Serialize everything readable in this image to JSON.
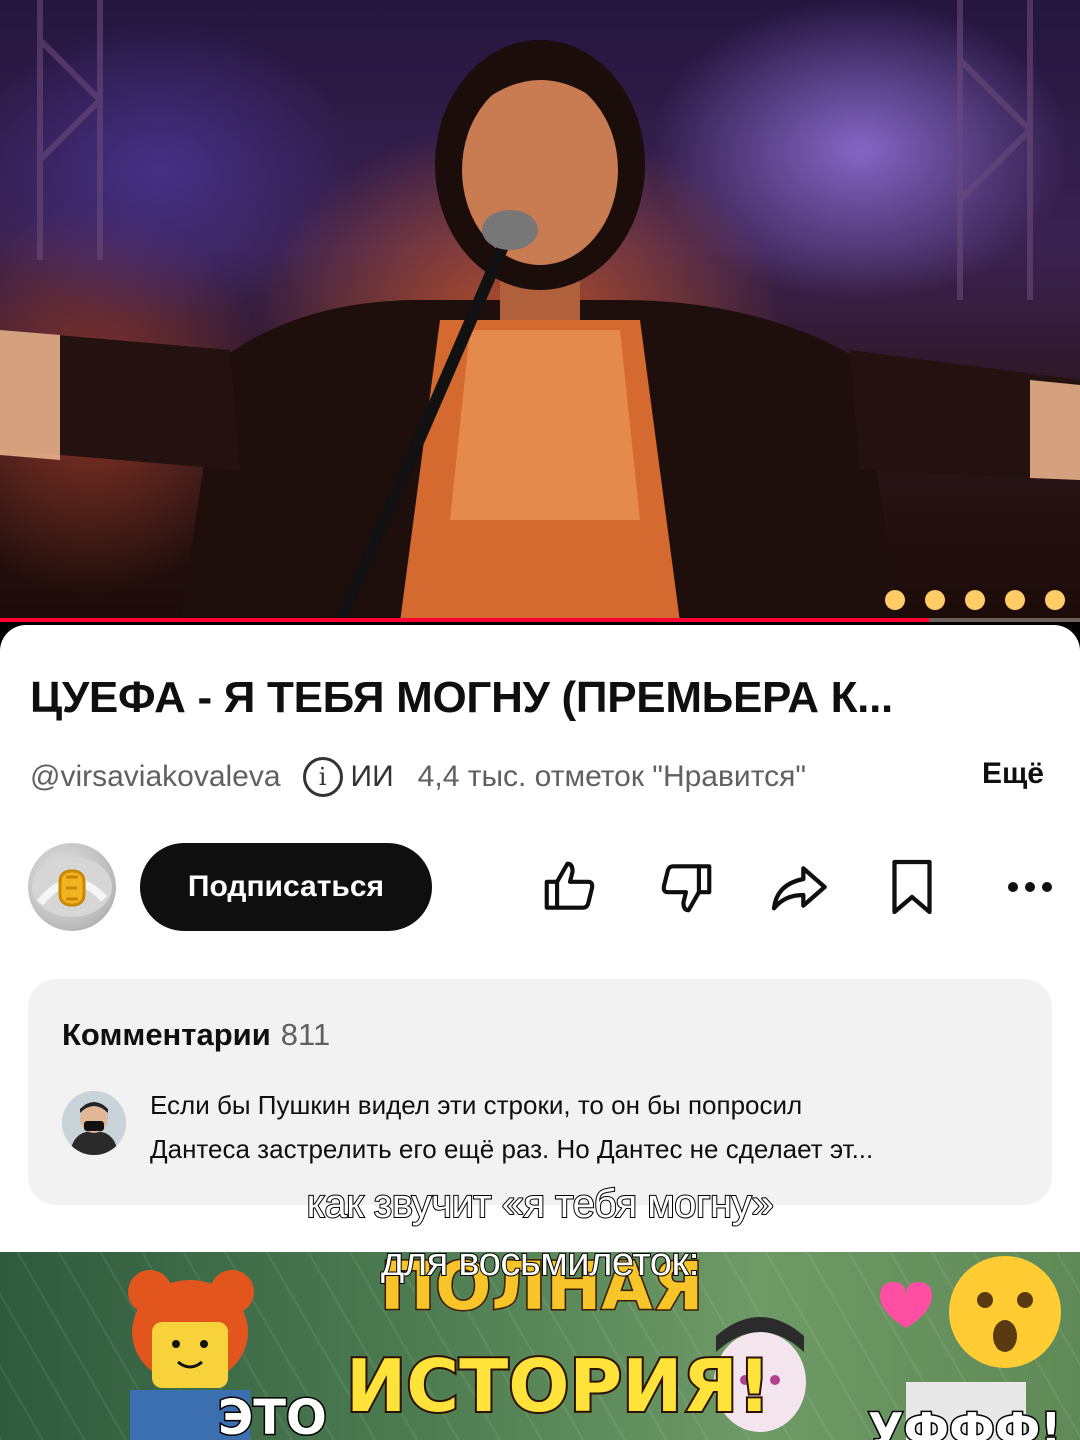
{
  "video": {
    "progress": 0.86,
    "accent_color": "#ff0033"
  },
  "details": {
    "title": "ЦУЕФА - Я ТЕБЯ МОГНУ (ПРЕМЬЕРА К...",
    "channel_handle": "@virsaviakovaleva",
    "info_icon": "info-icon",
    "ai_label": "ИИ",
    "likes_text": "4,4 тыс. отметок \"Нравится\"",
    "more_label": "Ещё"
  },
  "actions": {
    "subscribe_label": "Подписаться",
    "icons": [
      "thumb-up-icon",
      "thumb-down-icon",
      "share-icon",
      "save-icon",
      "more-icon"
    ]
  },
  "comments": {
    "label": "Комментарии",
    "count": "811",
    "top_comment_line1": "Если бы Пушкин видел эти строки, то он бы попросил",
    "top_comment_line2": "Дантеса  застрелить его ещё раз. Но Дантес не сделает эт..."
  },
  "caption": {
    "line1": "как звучит «я тебя могну»",
    "line2": "для восьмилеток:"
  },
  "thumbnail": {
    "line1": "ПОЛНАЯ",
    "line2": "ИСТОРИЯ!",
    "left_word": "ЭТО",
    "right_word": "УФФФ!"
  }
}
